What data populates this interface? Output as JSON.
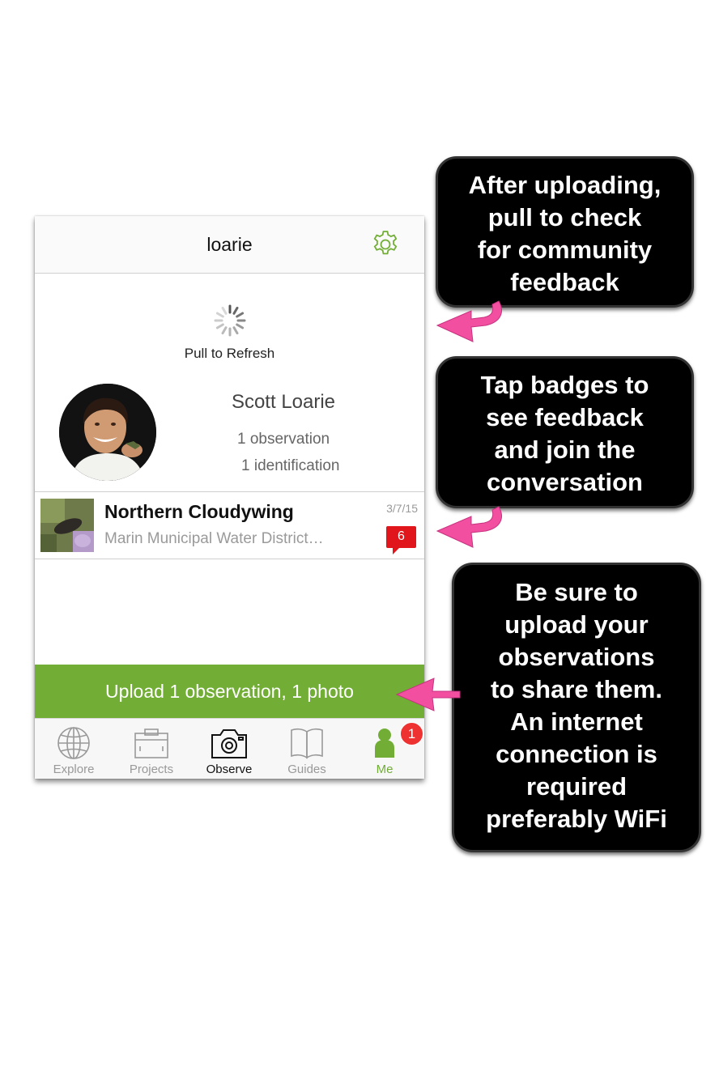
{
  "nav": {
    "title": "loarie",
    "settings_icon": "gear-icon"
  },
  "refresh": {
    "label": "Pull to Refresh"
  },
  "profile": {
    "name": "Scott Loarie",
    "observations": "1 observation",
    "identifications": "1 identification"
  },
  "observation": {
    "species": "Northern Cloudywing",
    "place": "Marin Municipal Water District…",
    "date": "3/7/15",
    "comment_count": "6"
  },
  "upload": {
    "label": "Upload 1 observation, 1 photo"
  },
  "tabs": [
    {
      "label": "Explore",
      "icon": "globe-icon"
    },
    {
      "label": "Projects",
      "icon": "clipboard-icon"
    },
    {
      "label": "Observe",
      "icon": "camera-icon"
    },
    {
      "label": "Guides",
      "icon": "book-icon"
    },
    {
      "label": "Me",
      "icon": "person-icon",
      "badge": "1"
    }
  ],
  "callouts": [
    {
      "text": "After uploading,\npull to  check\nfor community\nfeedback"
    },
    {
      "text": "Tap badges to\nsee feedback\nand join the\nconversation"
    },
    {
      "text": "Be sure to\nupload your\nobservations\nto share them.\nAn internet\nconnection is\nrequired\npreferably WiFi"
    }
  ],
  "colors": {
    "accent": "#72ae36",
    "badge": "#e0161c",
    "arrow": "#f24fa0",
    "callout_bg": "#000000"
  }
}
